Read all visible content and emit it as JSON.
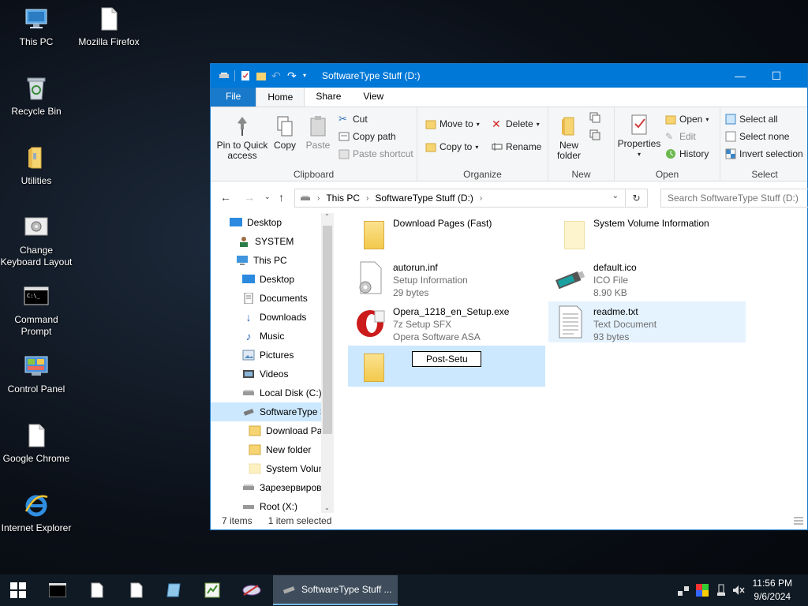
{
  "desktop": {
    "icons": [
      {
        "label": "This PC"
      },
      {
        "label": "Mozilla Firefox"
      },
      {
        "label": "Recycle Bin"
      },
      {
        "label": "Utilities"
      },
      {
        "label": "Change Keyboard Layout"
      },
      {
        "label": "Command Prompt"
      },
      {
        "label": "Control Panel"
      },
      {
        "label": "Google Chrome"
      },
      {
        "label": "Internet Explorer"
      }
    ]
  },
  "window": {
    "title": "SoftwareType Stuff (D:)",
    "controls": {
      "minimize": "—",
      "maximize": "☐"
    },
    "tabs": {
      "file": "File",
      "home": "Home",
      "share": "Share",
      "view": "View"
    },
    "ribbon": {
      "clipboard": {
        "label": "Clipboard",
        "pin": "Pin to Quick access",
        "copy": "Copy",
        "paste": "Paste",
        "cut": "Cut",
        "copy_path": "Copy path",
        "paste_shortcut": "Paste shortcut"
      },
      "organize": {
        "label": "Organize",
        "move_to": "Move to",
        "copy_to": "Copy to",
        "delete": "Delete",
        "rename": "Rename"
      },
      "new": {
        "label": "New",
        "new_folder": "New folder"
      },
      "open": {
        "label": "Open",
        "properties": "Properties",
        "open": "Open",
        "edit": "Edit",
        "history": "History"
      },
      "select": {
        "label": "Select",
        "select_all": "Select all",
        "select_none": "Select none",
        "invert": "Invert selection"
      }
    },
    "address": {
      "this_pc": "This PC",
      "current": "SoftwareType Stuff (D:)",
      "search_placeholder": "Search SoftwareType Stuff (D:)"
    },
    "nav_pane": [
      {
        "label": "Desktop"
      },
      {
        "label": "SYSTEM"
      },
      {
        "label": "This PC"
      },
      {
        "label": "Desktop"
      },
      {
        "label": "Documents"
      },
      {
        "label": "Downloads"
      },
      {
        "label": "Music"
      },
      {
        "label": "Pictures"
      },
      {
        "label": "Videos"
      },
      {
        "label": "Local Disk (C:)"
      },
      {
        "label": "SoftwareType S"
      },
      {
        "label": "Download Pa"
      },
      {
        "label": "New folder"
      },
      {
        "label": "System Volun"
      },
      {
        "label": "Зарезервиров"
      },
      {
        "label": "Root (X:)"
      }
    ],
    "files": [
      {
        "name": "Download Pages (Fast)"
      },
      {
        "name": "System Volume Information"
      },
      {
        "name": "autorun.inf",
        "type": "Setup Information",
        "size": "29 bytes"
      },
      {
        "name": "default.ico",
        "type": "ICO File",
        "size": "8.90 KB"
      },
      {
        "name": "Opera_1218_en_Setup.exe",
        "type": "7z Setup SFX",
        "company": "Opera Software ASA"
      },
      {
        "name": "readme.txt",
        "type": "Text Document",
        "size": "93 bytes"
      },
      {
        "rename_value": "Post-Setu"
      }
    ],
    "status": {
      "count": "7 items",
      "selected": "1 item selected"
    }
  },
  "taskbar": {
    "active_window": "SoftwareType Stuff ...",
    "time": "11:56 PM",
    "date": "9/6/2024"
  }
}
